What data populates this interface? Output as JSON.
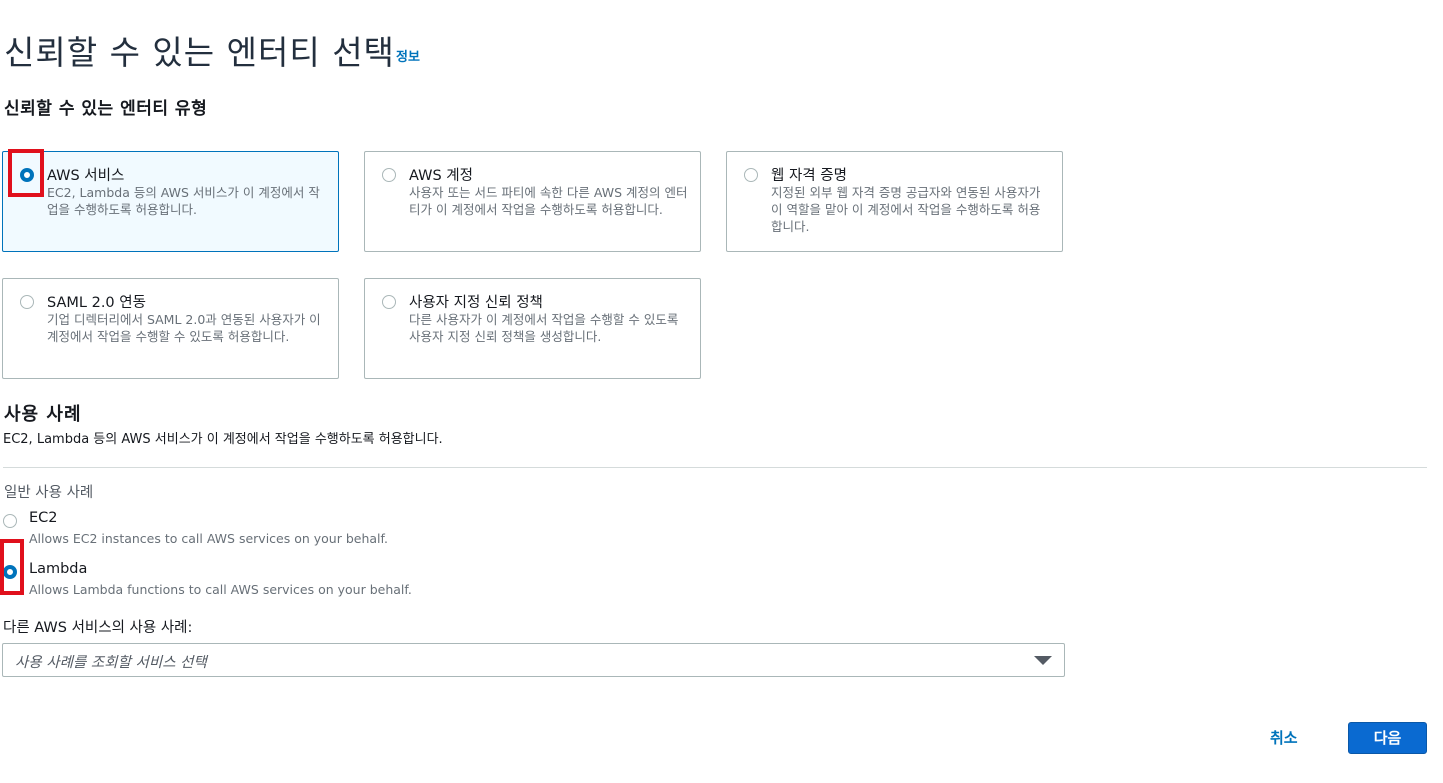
{
  "header": {
    "title": "신뢰할 수 있는 엔터티 선택",
    "info_link": "정보"
  },
  "entity_type": {
    "heading": "신뢰할 수 있는 엔터티 유형",
    "selected": "aws_service",
    "tiles": [
      {
        "id": "aws_service",
        "title": "AWS 서비스",
        "description": "EC2, Lambda 등의 AWS 서비스가 이 계정에서 작업을 수행하도록 허용합니다."
      },
      {
        "id": "aws_account",
        "title": "AWS 계정",
        "description": "사용자 또는 서드 파티에 속한 다른 AWS 계정의 엔터티가 이 계정에서 작업을 수행하도록 허용합니다."
      },
      {
        "id": "web_identity",
        "title": "웹 자격 증명",
        "description": "지정된 외부 웹 자격 증명 공급자와 연동된 사용자가 이 역할을 맡아 이 계정에서 작업을 수행하도록 허용합니다."
      },
      {
        "id": "saml",
        "title": "SAML 2.0 연동",
        "description": "기업 디렉터리에서 SAML 2.0과 연동된 사용자가 이 계정에서 작업을 수행할 수 있도록 허용합니다."
      },
      {
        "id": "custom_trust",
        "title": "사용자 지정 신뢰 정책",
        "description": "다른 사용자가 이 계정에서 작업을 수행할 수 있도록 사용자 지정 신뢰 정책을 생성합니다."
      }
    ]
  },
  "use_case": {
    "heading": "사용 사례",
    "description": "EC2, Lambda 등의 AWS 서비스가 이 계정에서 작업을 수행하도록 허용합니다.",
    "common_label": "일반 사용 사례",
    "selected": "lambda",
    "options": [
      {
        "id": "ec2",
        "title": "EC2",
        "description": "Allows EC2 instances to call AWS services on your behalf."
      },
      {
        "id": "lambda",
        "title": "Lambda",
        "description": "Allows Lambda functions to call AWS services on your behalf."
      }
    ],
    "other_label": "다른 AWS 서비스의 사용 사례:",
    "select_placeholder": "사용 사례를 조회할 서비스 선택"
  },
  "footer": {
    "cancel_label": "취소",
    "next_label": "다음"
  },
  "colors": {
    "accent": "#0073bb",
    "primary_button": "#0a6ad1",
    "highlight_box": "#e0101c",
    "selected_tile_bg": "#f1faff"
  }
}
